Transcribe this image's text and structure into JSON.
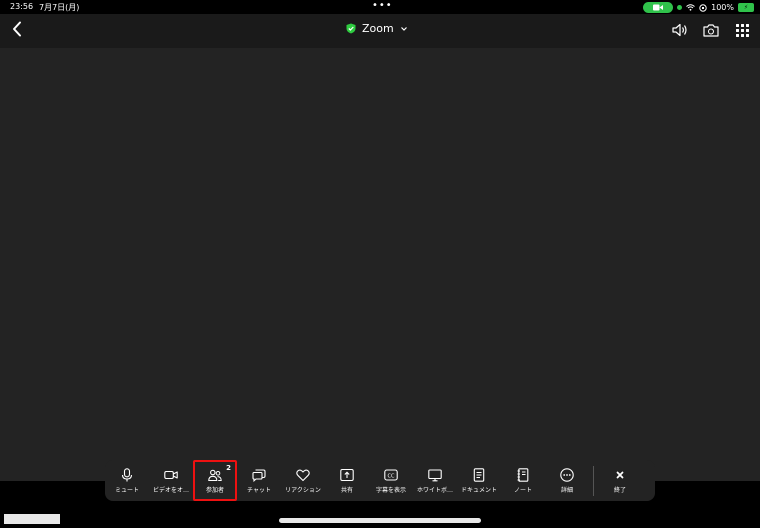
{
  "status": {
    "time": "23:56",
    "date": "7月7日(月)",
    "battery": "100%"
  },
  "header": {
    "title": "Zoom"
  },
  "toolbar": {
    "buttons": [
      {
        "label": "ミュート",
        "icon": "mic-icon"
      },
      {
        "label": "ビデオをオ…",
        "icon": "video-icon"
      },
      {
        "label": "参加者",
        "icon": "participants-icon",
        "badge": "2"
      },
      {
        "label": "チャット",
        "icon": "chat-icon"
      },
      {
        "label": "リアクション",
        "icon": "heart-icon"
      },
      {
        "label": "共有",
        "icon": "share-icon"
      },
      {
        "label": "字幕を表示",
        "icon": "cc-icon"
      },
      {
        "label": "ホワイトボ…",
        "icon": "whiteboard-icon"
      },
      {
        "label": "ドキュメント",
        "icon": "document-icon"
      },
      {
        "label": "ノート",
        "icon": "notes-icon"
      },
      {
        "label": "詳細",
        "icon": "more-icon"
      }
    ],
    "end": {
      "label": "終了",
      "icon": "close-icon"
    }
  }
}
